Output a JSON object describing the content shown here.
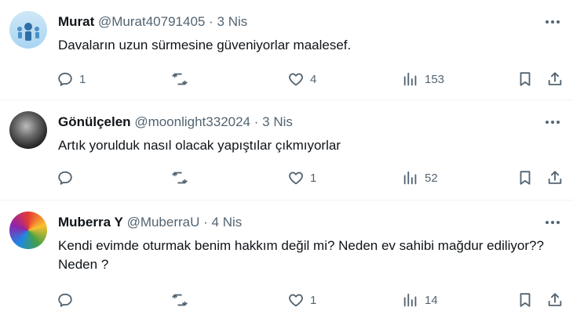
{
  "tweets": [
    {
      "name": "Murat",
      "handle": "@Murat40791405",
      "dot": "·",
      "date": "3 Nis",
      "text": "Davaların uzun sürmesine güveniyorlar maalesef.",
      "replies": "1",
      "retweets": "",
      "likes": "4",
      "views": "153"
    },
    {
      "name": "Gönülçelen",
      "handle": "@moonlight332024",
      "dot": "·",
      "date": "3 Nis",
      "text": "Artık yorulduk nasıl olacak yapıştılar çıkmıyorlar",
      "replies": "",
      "retweets": "",
      "likes": "1",
      "views": "52"
    },
    {
      "name": "Muberra Y",
      "handle": "@MuberraU",
      "dot": "·",
      "date": "4 Nis",
      "text": "Kendi evimde oturmak benim hakkım değil mi? Neden ev sahibi mağdur ediliyor?? Neden ?",
      "replies": "",
      "retweets": "",
      "likes": "1",
      "views": "14"
    }
  ],
  "icons": {
    "reply": "reply-icon",
    "retweet": "retweet-icon",
    "like": "heart-icon",
    "views": "views-icon",
    "bookmark": "bookmark-icon",
    "share": "share-icon",
    "more": "more-icon"
  },
  "colors": {
    "text": "#0f1419",
    "secondary": "#536471",
    "divider": "#eff3f4"
  }
}
